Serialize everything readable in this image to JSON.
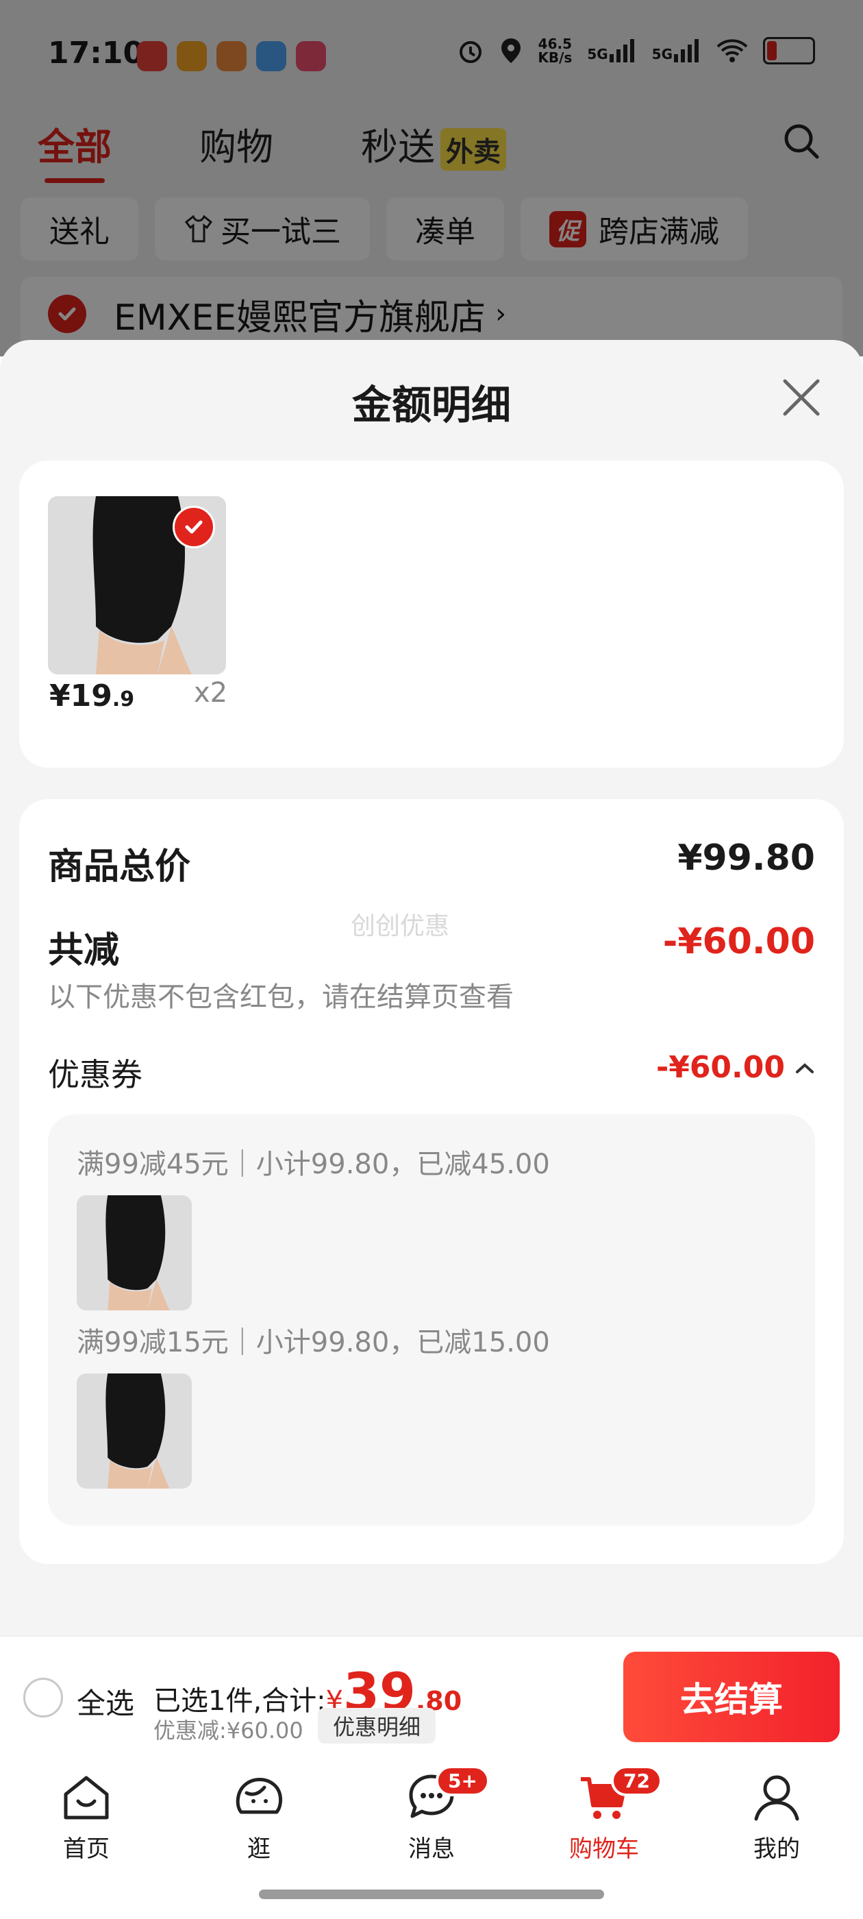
{
  "status_bar": {
    "time": "17:10",
    "net_speed": "46.5",
    "net_unit": "KB/s",
    "signal1": "5G",
    "signal2": "5G"
  },
  "top_tabs": [
    {
      "label": "全部"
    },
    {
      "label": "购物"
    },
    {
      "label": "秒送"
    }
  ],
  "waimai_badge": "外卖",
  "filter_chips": [
    {
      "label": "送礼"
    },
    {
      "label": "买一试三"
    },
    {
      "label": "凑单"
    },
    {
      "label": "跨店满减",
      "promo": "促"
    }
  ],
  "store": {
    "name": "EMXEE嫚熙官方旗舰店",
    "arrow": "›"
  },
  "sheet": {
    "title": "金额明细",
    "product": {
      "price_int": "¥19",
      "price_dec": ".9",
      "qty": "x2"
    },
    "summary": {
      "total_label": "商品总价",
      "total_value": "¥99.80",
      "reduce_label": "共减",
      "reduce_value": "-¥60.00",
      "note": "以下优惠不包含红包，请在结算页查看",
      "watermark": "创创优惠",
      "coupon_label": "优惠券",
      "coupon_value": "-¥60.00",
      "coupon_details": [
        {
          "text": "满99减45元｜小计99.80，已减45.00"
        },
        {
          "text": "满99减15元｜小计99.80，已减15.00"
        }
      ]
    }
  },
  "checkout": {
    "select_all": "全选",
    "selected_text": "已选1件,合计:",
    "yen": "¥",
    "total_int": "39",
    "total_dec": ".80",
    "discount_text": "优惠减:¥60.00",
    "detail_button": "优惠明细",
    "submit": "去结算"
  },
  "tabbar": [
    {
      "label": "首页",
      "icon": "home-icon"
    },
    {
      "label": "逛",
      "icon": "browse-icon"
    },
    {
      "label": "消息",
      "icon": "message-icon",
      "badge": "5+"
    },
    {
      "label": "购物车",
      "icon": "cart-icon",
      "badge": "72",
      "active": true
    },
    {
      "label": "我的",
      "icon": "profile-icon"
    }
  ],
  "colors": {
    "accent": "#e0241c",
    "muted": "#888888",
    "sheet_bg": "#f4f4f4"
  }
}
